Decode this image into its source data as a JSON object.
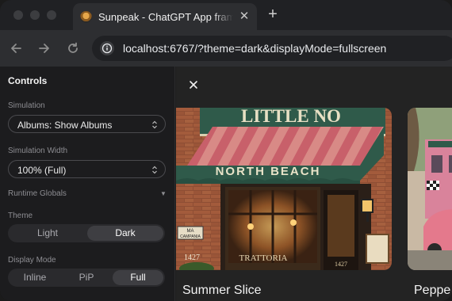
{
  "browser": {
    "tab_title": "Sunpeak - ChatGPT App framework",
    "tab_close_glyph": "✕",
    "new_tab_glyph": "+",
    "url": "localhost:6767/?theme=dark&displayMode=fullscreen",
    "icons": [
      "back-arrow-icon",
      "forward-arrow-icon",
      "reload-icon",
      "site-info-icon"
    ]
  },
  "sidebar": {
    "title": "Controls",
    "simulation_label": "Simulation",
    "simulation_value": "Albums: Show Albums",
    "width_label": "Simulation Width",
    "width_value": "100% (Full)",
    "runtime_globals_label": "Runtime Globals",
    "runtime_globals_caret": "▼",
    "theme_label": "Theme",
    "theme_options": [
      "Light",
      "Dark"
    ],
    "theme_selected": "Dark",
    "display_mode_label": "Display Mode",
    "display_mode_options": [
      "Inline",
      "PiP",
      "Full"
    ],
    "display_mode_selected": "Full"
  },
  "main": {
    "close_icon": "close-icon",
    "albums": [
      {
        "title": "Summer Slice",
        "sign_lines": [
          "LITTLE NO",
          "NORTH BEACH"
        ],
        "awning_text": "NORTH BEACH",
        "plaque_text": [
          "MA",
          "CAMPANIA"
        ],
        "street_number": "1427",
        "window_text": "TRATTORIA",
        "door_number": "1427"
      },
      {
        "title": "Peppe"
      }
    ]
  },
  "colors": {
    "tab_strip": "#202124",
    "toolbar": "#2d2e31",
    "sidebar": "#1c1c1e",
    "main": "#232323",
    "awning_green": "#2f5a4a",
    "awning_red": "#c8606a"
  }
}
